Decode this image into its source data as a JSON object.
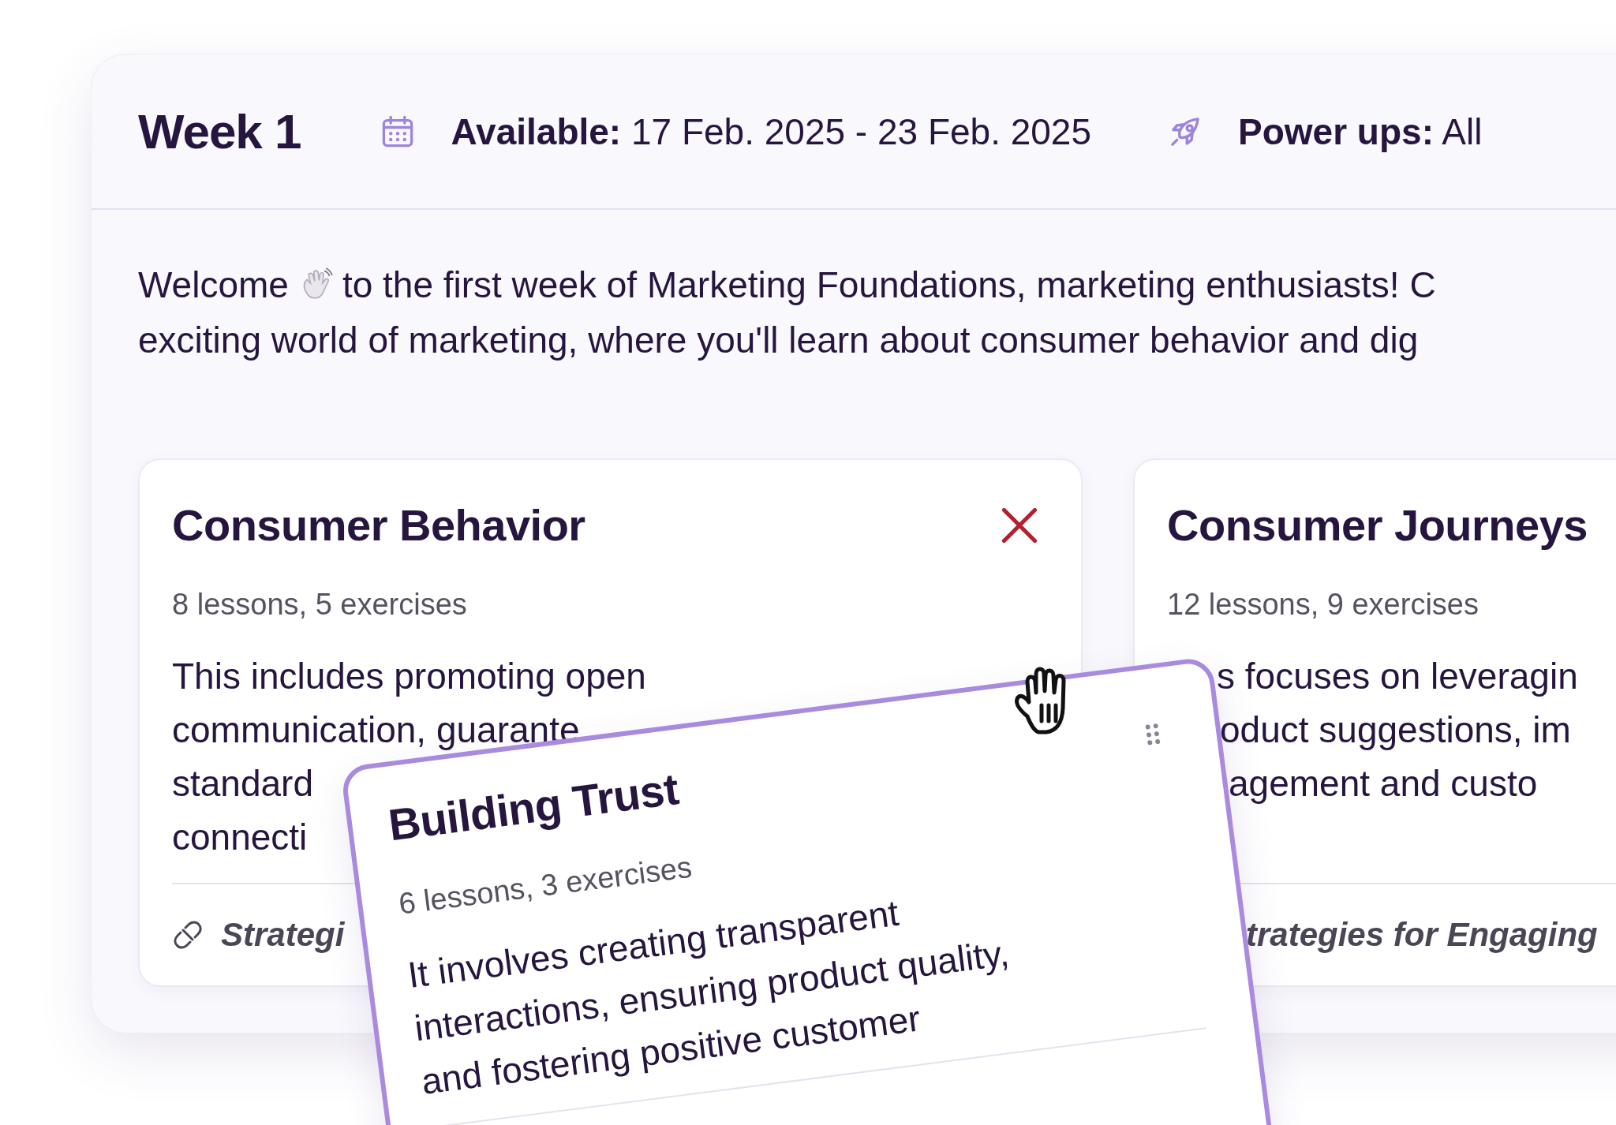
{
  "week": {
    "title": "Week 1",
    "available": {
      "label": "Available:",
      "value": "17 Feb. 2025 - 23 Feb. 2025"
    },
    "power_ups": {
      "label": "Power ups:",
      "value": "All"
    }
  },
  "welcome": {
    "lead": "Welcome",
    "rest": "to the first week of Marketing Foundations, marketing enthusiasts! C",
    "line2": "exciting world of marketing, where you'll learn about consumer behavior  and dig"
  },
  "modules": [
    {
      "title": "Consumer Behavior",
      "meta": "8 lessons, 5 exercises",
      "description_lines": [
        "This includes promoting open",
        "communication, guarante",
        "standard",
        "connecti"
      ],
      "link": "Strategi",
      "link_icon": true,
      "removable": true
    },
    {
      "title": "Consumer Journeys",
      "meta": "12 lessons, 9 exercises",
      "description_lines": [
        "s focuses on leveragin",
        "oduct suggestions, im",
        "agement and custo"
      ],
      "link": "trategies for Engaging"
    }
  ],
  "dragged_module": {
    "title": "Building Trust",
    "meta": "6 lessons, 3 exercises",
    "description_lines": [
      "It involves creating transparent",
      "interactions, ensuring product quality,",
      "and fostering positive customer"
    ]
  }
}
